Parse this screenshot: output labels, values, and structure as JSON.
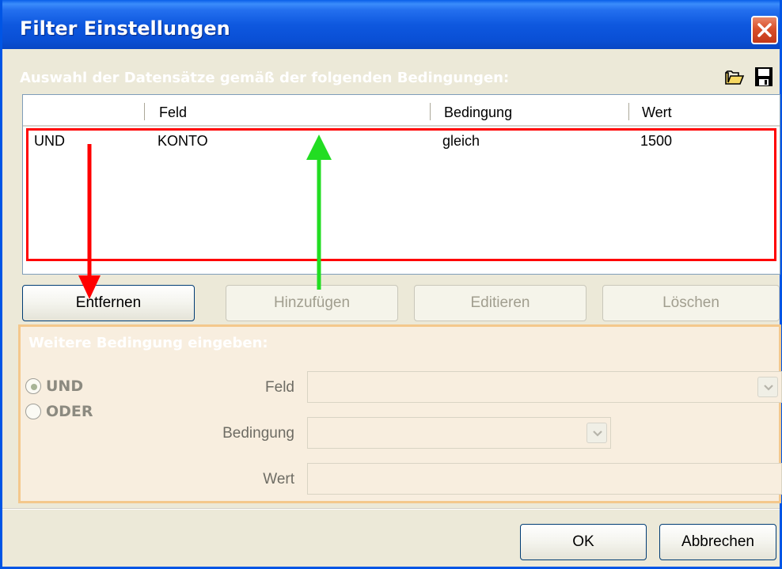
{
  "window": {
    "title": "Filter Einstellungen"
  },
  "conditions": {
    "header": "Auswahl der Datensätze gemäß der folgenden Bedingungen:",
    "columns": [
      "",
      "Feld",
      "Bedingung",
      "Wert"
    ],
    "rows": [
      {
        "logic": "UND",
        "field": "KONTO",
        "condition": "gleich",
        "value": "1500"
      }
    ]
  },
  "actions": {
    "remove": "Entfernen",
    "add": "Hinzufügen",
    "edit": "Editieren",
    "delete": "Löschen"
  },
  "new_condition": {
    "title": "Weitere Bedingung eingeben:",
    "and_label": "UND",
    "or_label": "ODER",
    "selected": "UND",
    "field_label": "Feld",
    "condition_label": "Bedingung",
    "value_label": "Wert",
    "field_value": "",
    "condition_value": "",
    "value_value": ""
  },
  "footer": {
    "ok": "OK",
    "cancel": "Abbrechen"
  },
  "icons": {
    "open": "folder-open-icon",
    "save": "floppy-disk-icon",
    "close": "close-icon"
  },
  "colors": {
    "title_bar": "#0a50d6",
    "highlight_box": "#ff0000",
    "arrow_red": "#ff0000",
    "arrow_green": "#22dd22",
    "group_border": "#f4c88c"
  }
}
